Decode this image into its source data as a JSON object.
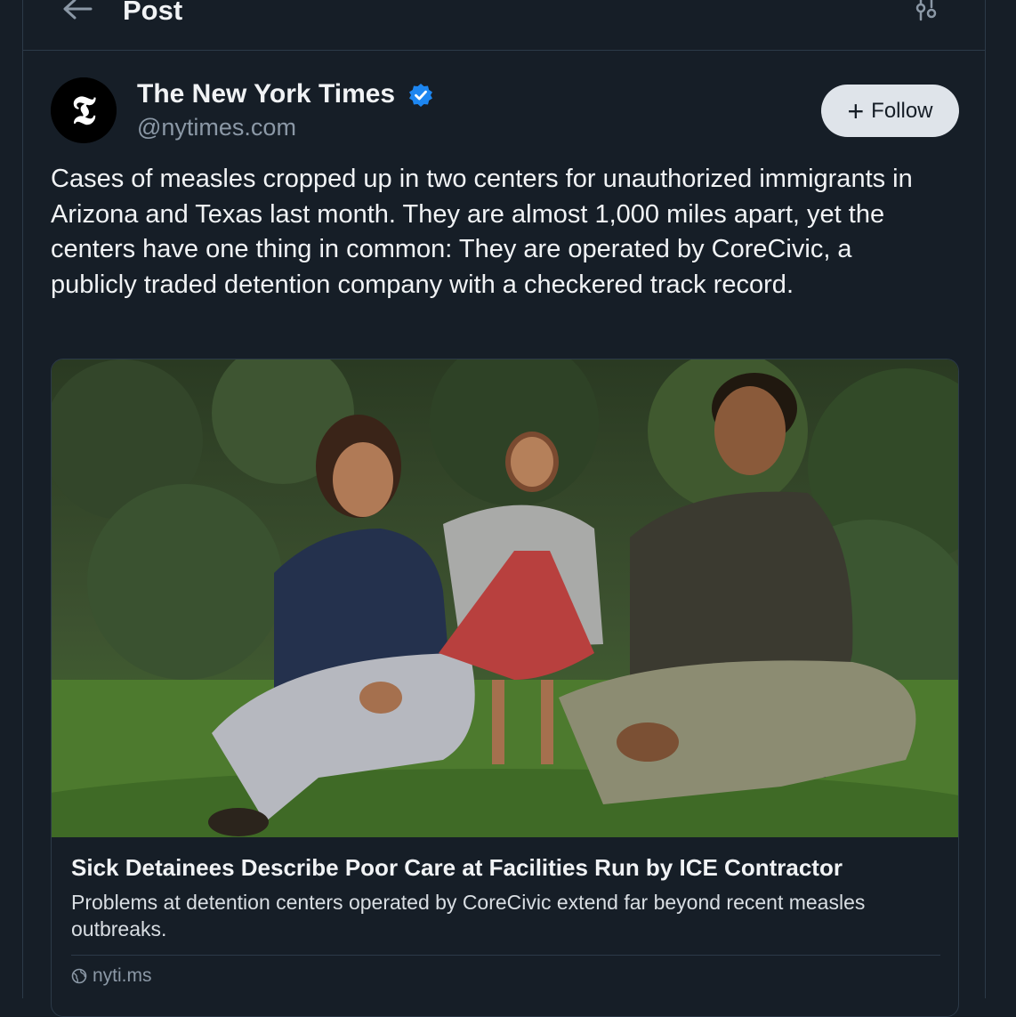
{
  "header": {
    "title": "Post"
  },
  "post": {
    "author_name": "The New York Times",
    "handle": "@nytimes.com",
    "avatar_letter": "𝕿",
    "follow_label": "Follow",
    "text": "Cases of measles cropped up in two centers for unauthorized immigrants in Arizona and Texas last month. They are almost 1,000 miles apart, yet the centers have one thing in common: They are operated by CoreCivic, a publicly traded detention company with a checkered track record."
  },
  "link_card": {
    "headline": "Sick Detainees Describe Poor Care at Facilities Run by ICE Contractor",
    "summary": "Problems at detention centers operated by CoreCivic extend far beyond recent measles outbreaks.",
    "domain": "nyti.ms"
  },
  "colors": {
    "background": "#161e27",
    "border": "#2c3a48",
    "verified_blue": "#1d86f0",
    "follow_bg": "#dfe4ea"
  }
}
